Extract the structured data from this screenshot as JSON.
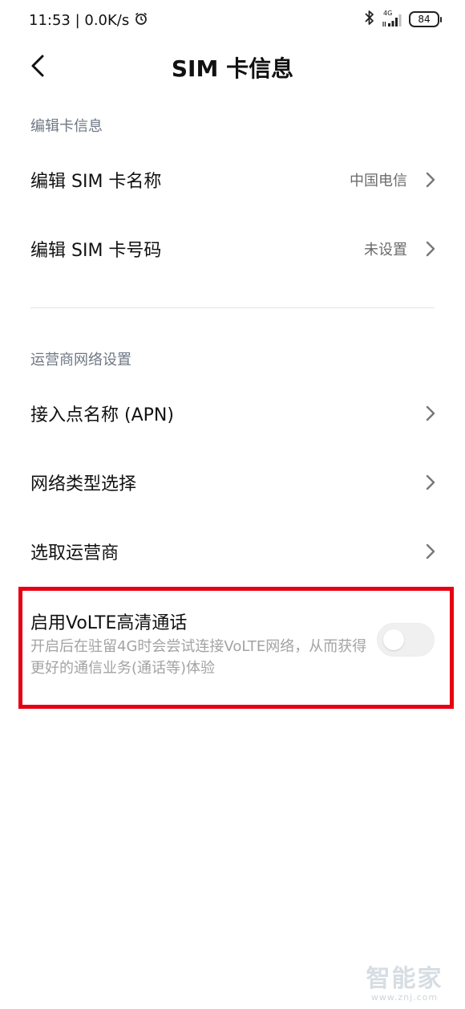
{
  "status_bar": {
    "time_speed": "11:53 | 0.0K/s",
    "network_type": "4G",
    "battery_level": "84",
    "icons": [
      "alarm-icon",
      "bluetooth-icon",
      "signal-icon",
      "battery-icon"
    ]
  },
  "header": {
    "title": "SIM 卡信息",
    "back_icon": "chevron-left-icon"
  },
  "sections": {
    "edit_card_header": "编辑卡信息",
    "carrier_header": "运营商网络设置"
  },
  "edit_items": [
    {
      "label": "编辑 SIM 卡名称",
      "value": "中国电信"
    },
    {
      "label": "编辑 SIM 卡号码",
      "value": "未设置"
    }
  ],
  "carrier_items": [
    {
      "label": "接入点名称 (APN)"
    },
    {
      "label": "网络类型选择"
    },
    {
      "label": "选取运营商"
    }
  ],
  "volte": {
    "title": "启用VoLTE高清通话",
    "description": "开启后在驻留4G时会尝试连接VoLTE网络，从而获得更好的通信业务(通话等)体验",
    "enabled": false
  },
  "highlight_color": "#e60012",
  "watermark": {
    "main": "智能家",
    "sub": "www.znj.com"
  }
}
